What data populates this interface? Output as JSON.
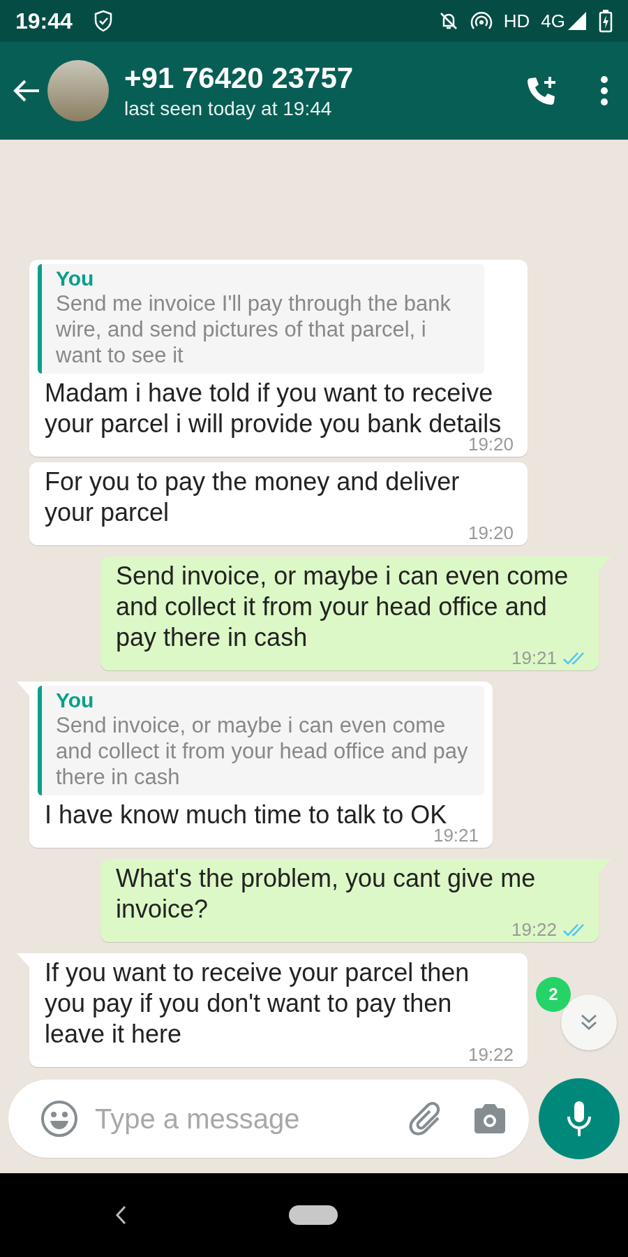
{
  "status_bar": {
    "time": "19:44",
    "network": "HD",
    "generation": "4G"
  },
  "header": {
    "title": "+91 76420 23757",
    "subtitle": "last seen today at 19:44"
  },
  "messages": [
    {
      "kind": "incoming",
      "tail": false,
      "quote": {
        "author": "You",
        "text": "Send me invoice I'll pay through the bank wire, and send pictures of that parcel, i want to see it"
      },
      "text": "Madam i have told if you want to receive your parcel i will provide you bank details",
      "time": "19:20"
    },
    {
      "kind": "incoming",
      "tail": false,
      "text": "For you to pay the money and deliver your parcel",
      "time": "19:20"
    },
    {
      "kind": "outgoing",
      "tail": true,
      "text": "Send invoice, or maybe i can even come and collect it from your head office and pay there in cash",
      "time": "19:21",
      "read": true
    },
    {
      "kind": "incoming",
      "tail": true,
      "quote": {
        "author": "You",
        "text": "Send invoice, or maybe i can even come and collect it from your head office and pay there in cash"
      },
      "text": "I have know much time to talk to OK",
      "time": "19:21"
    },
    {
      "kind": "outgoing",
      "tail": true,
      "text": "What's the problem, you cant give me invoice?",
      "time": "19:22",
      "read": true
    },
    {
      "kind": "incoming",
      "tail": true,
      "text": "If you want to receive your parcel then you pay if you don't want to pay then leave it here",
      "time": "19:22"
    }
  ],
  "unread_badge": "2",
  "composer": {
    "placeholder": "Type a message"
  }
}
